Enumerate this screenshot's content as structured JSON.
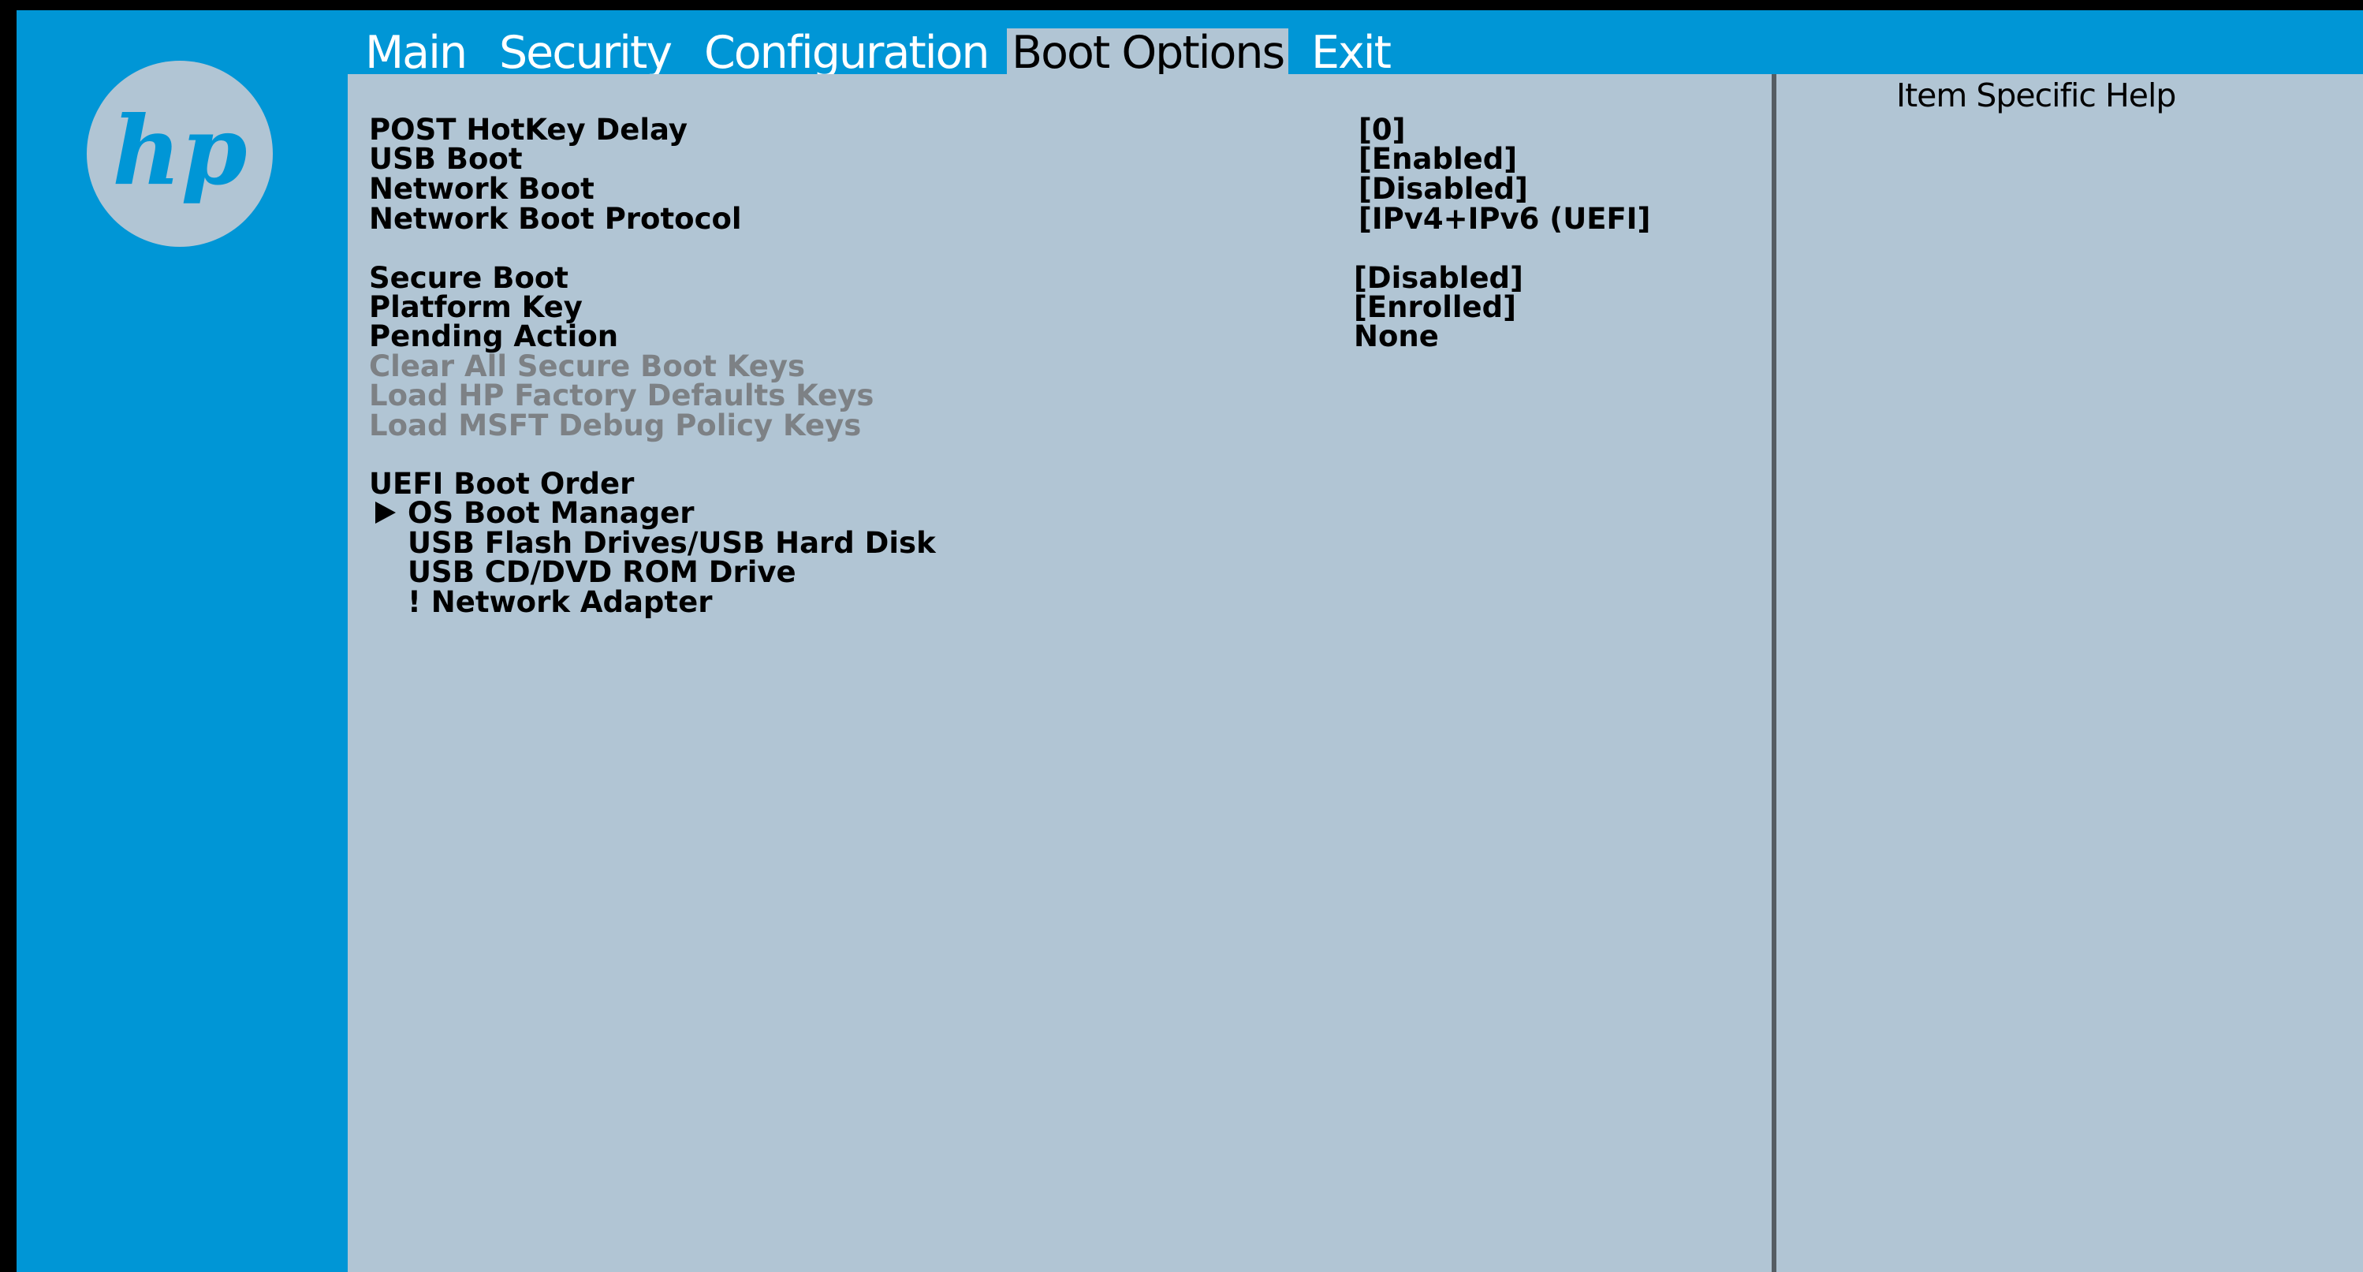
{
  "brand": {
    "logo_text": "hp",
    "colors": {
      "frame_blue": "#0096d6",
      "panel_gray_blue": "#b1c5d4",
      "disabled_text": "#7d8185",
      "divider": "#555d63"
    }
  },
  "tabs": [
    {
      "label": "Main",
      "active": false
    },
    {
      "label": "Security",
      "active": false
    },
    {
      "label": "Configuration",
      "active": false
    },
    {
      "label": "Boot Options",
      "active": true
    },
    {
      "label": "Exit",
      "active": false
    }
  ],
  "settings": {
    "post_hotkey_delay": {
      "label": "POST HotKey Delay",
      "value": "[0]"
    },
    "usb_boot": {
      "label": "USB Boot",
      "value": "[Enabled]"
    },
    "network_boot": {
      "label": "Network Boot",
      "value": "[Disabled]"
    },
    "network_boot_protocol": {
      "label": "Network Boot Protocol",
      "value": "[IPv4+IPv6 (UEFI]"
    },
    "secure_boot": {
      "label": "Secure Boot",
      "value": "[Disabled]"
    },
    "platform_key": {
      "label": "Platform Key",
      "value": "[Enrolled]"
    },
    "pending_action": {
      "label": "Pending Action",
      "value": "None"
    },
    "clear_all_secure_boot_keys": {
      "label": "Clear All Secure Boot Keys"
    },
    "load_hp_factory_defaults_keys": {
      "label": "Load HP Factory Defaults Keys"
    },
    "load_msft_debug_policy_keys": {
      "label": "Load MSFT Debug Policy Keys"
    }
  },
  "uefi_boot_order": {
    "header": "UEFI Boot Order",
    "items": [
      "OS Boot Manager",
      "USB Flash Drives/USB Hard Disk",
      "USB CD/DVD ROM Drive",
      "! Network Adapter"
    ],
    "selected_index": 0
  },
  "help_panel": {
    "title": "Item Specific Help"
  },
  "icons": {
    "selection_arrow": "triangle-right-icon",
    "logo": "hp-logo-icon"
  }
}
